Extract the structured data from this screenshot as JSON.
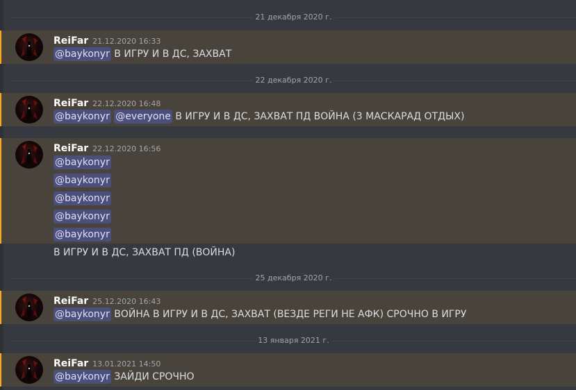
{
  "colors": {
    "background": "#36393f",
    "highlight": "#48443b",
    "highlight_border": "#faa81a",
    "mention_bg": "#4b4f7c",
    "mention_text": "#dee0fc",
    "text": "#dcddde",
    "muted": "#a3a6aa"
  },
  "dividers": [
    "21 декабря 2020 г.",
    "22 декабря 2020 г.",
    "25 декабря 2020 г.",
    "13 января 2021 г."
  ],
  "messages": [
    {
      "username": "ReiFar",
      "timestamp": "21.12.2020 16:33",
      "mention": "@baykonyr",
      "text": "В ИГРУ И В ДС, ЗАХВАТ"
    },
    {
      "username": "ReiFar",
      "timestamp": "22.12.2020 16:48",
      "mention": "@baykonyr",
      "mention2": "@everyone",
      "text": "В ИГРУ И В ДС, ЗАХВАТ ПД ВОЙНА (3 МАСКАРАД ОТДЫХ)"
    },
    {
      "username": "ReiFar",
      "timestamp": "22.12.2020 16:56",
      "mentions": [
        "@baykonyr",
        "@baykonyr",
        "@baykonyr",
        "@baykonyr",
        "@baykonyr"
      ],
      "text": "В ИГРУ И В ДС, ЗАХВАТ ПД (ВОЙНА)"
    },
    {
      "username": "ReiFar",
      "timestamp": "25.12.2020 16:43",
      "mention": "@baykonyr",
      "text": "ВОЙНА В ИГРУ И В ДС, ЗАХВАТ (ВЕЗДЕ РЕГИ НЕ АФК) СРОЧНО В ИГРУ"
    },
    {
      "username": "ReiFar",
      "timestamp": "13.01.2021 14:50",
      "mention": "@baykonyr",
      "text": "ЗАЙДИ СРОЧНО"
    }
  ]
}
